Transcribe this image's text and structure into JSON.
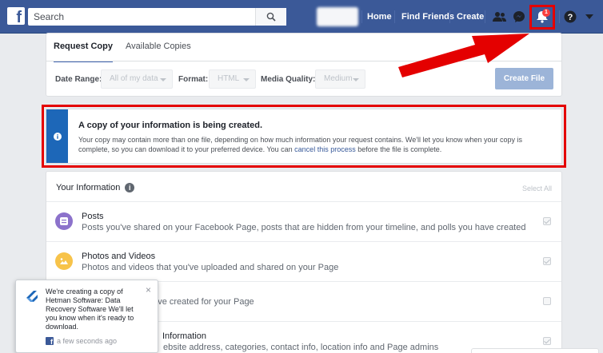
{
  "topbar": {
    "logo_letter": "f",
    "search_placeholder": "Search",
    "nav": [
      "Home",
      "Find Friends",
      "Create"
    ],
    "notification_count": "1"
  },
  "tabs": [
    {
      "label": "Request Copy",
      "active": true
    },
    {
      "label": "Available Copies",
      "active": false
    }
  ],
  "filters": {
    "date_range_label": "Date Range:",
    "date_range_value": "All of my data",
    "format_label": "Format:",
    "format_value": "HTML",
    "media_quality_label": "Media Quality:",
    "media_quality_value": "Medium",
    "create_button": "Create File"
  },
  "banner": {
    "title": "A copy of your information is being created.",
    "body_before_link": "Your copy may contain more than one file, depending on how much information your request contains. We'll let you know when your copy is complete, so you can download it to your preferred device. You can ",
    "link": "cancel this process",
    "body_after_link": " before the file is complete."
  },
  "your_information": {
    "heading": "Your Information",
    "select_all": "Select All",
    "rows": [
      {
        "title": "Posts",
        "description": "Posts you've shared on your Facebook Page, posts that are hidden from your timeline, and polls you have created",
        "icon": "posts-icon",
        "color": "#8c72cb"
      },
      {
        "title": "Photos and Videos",
        "description": "Photos and videos that you've uploaded and shared on your Page",
        "icon": "photos-icon",
        "color": "#f7c34a"
      },
      {
        "title": "",
        "description": "u've created for your Page",
        "icon": "events-icon",
        "color": "#e9ebee"
      },
      {
        "title": "Information",
        "description": "ebsite address, categories, contact info, location info and Page admins",
        "icon": "info-icon",
        "color": "#e9ebee"
      }
    ]
  },
  "toast": {
    "message": "We're creating a copy of Hetman Software: Data Recovery Software We'll let you know when it's ready to download.",
    "time": "a few seconds ago",
    "close": "×"
  },
  "colors": {
    "brand": "#3b5998",
    "annotation_red": "#e40000",
    "info_strip": "#1d67b8"
  }
}
